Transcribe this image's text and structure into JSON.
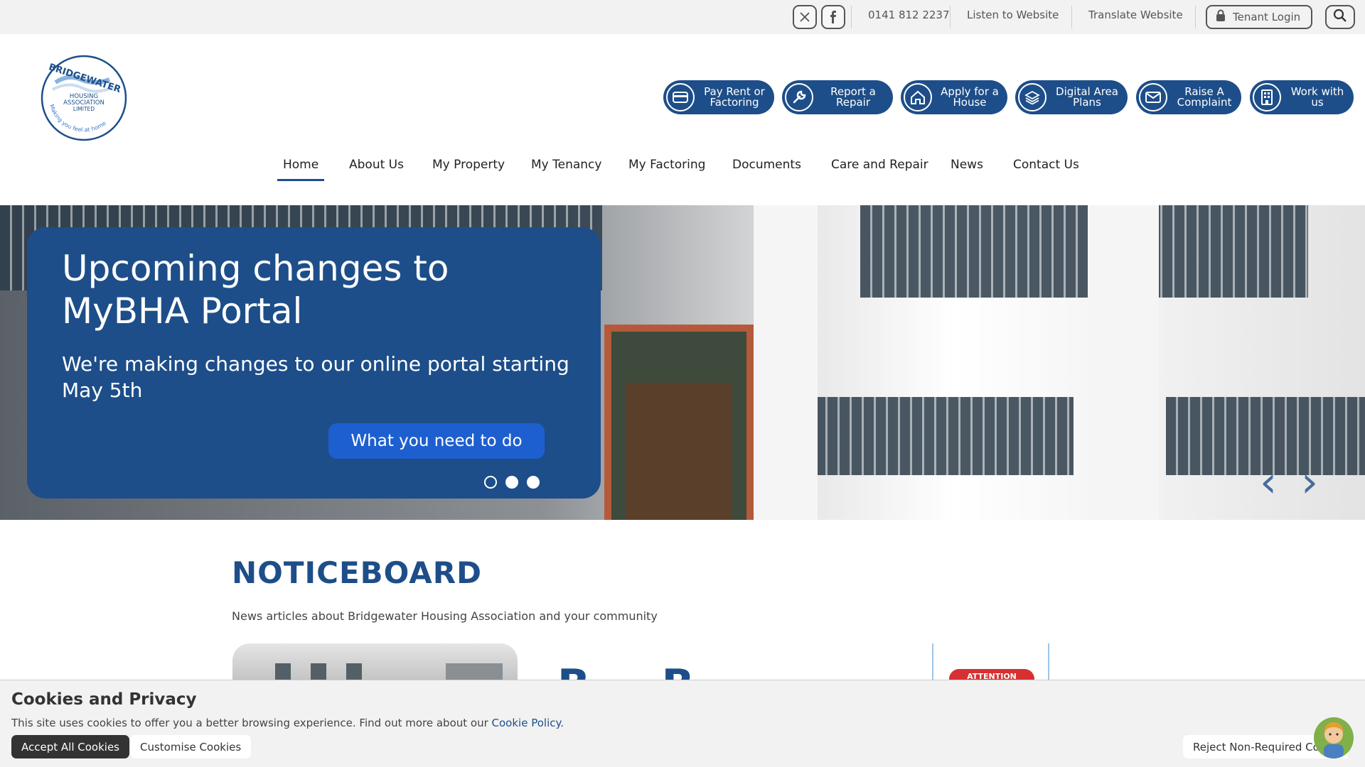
{
  "topbar": {
    "twitter_icon": "x-twitter-icon",
    "facebook_icon": "facebook-icon",
    "phone": "0141 812 2237",
    "listen": "Listen to Website",
    "translate": "Translate Website",
    "tenant_login": "Tenant Login"
  },
  "logo": {
    "name": "BRIDGEWATER",
    "line1": "HOUSING",
    "line2": "ASSOCIATION",
    "line3": "LIMITED",
    "tagline": "Making you feel at home"
  },
  "quick_actions": [
    {
      "label": "Pay Rent or\nFactoring",
      "icon": "card-icon"
    },
    {
      "label": "Report a\nRepair",
      "icon": "wrench-icon"
    },
    {
      "label": "Apply for a\nHouse",
      "icon": "house-icon"
    },
    {
      "label": "Digital Area\nPlans",
      "icon": "layers-icon"
    },
    {
      "label": "Raise A\nComplaint",
      "icon": "envelope-icon"
    },
    {
      "label": "Work with\nus",
      "icon": "building-icon"
    }
  ],
  "nav": [
    {
      "label": "Home",
      "active": true
    },
    {
      "label": "About Us"
    },
    {
      "label": "My Property"
    },
    {
      "label": "My Tenancy"
    },
    {
      "label": "My Factoring"
    },
    {
      "label": "Documents"
    },
    {
      "label": "Care and Repair"
    },
    {
      "label": "News"
    },
    {
      "label": "Contact Us"
    }
  ],
  "hero": {
    "title": "Upcoming changes to MyBHA Portal",
    "subtitle": "We're making changes to our online portal starting May 5th",
    "cta": "What you need to do",
    "slides": 3,
    "active_slide": 1
  },
  "noticeboard": {
    "title": "NOTICEBOARD",
    "description": "News articles about Bridgewater Housing Association and your community",
    "card2_text": "B B",
    "card3_badge": "ATTENTION"
  },
  "cookies": {
    "title": "Cookies and Privacy",
    "text": "This site uses cookies to offer you a better browsing experience. Find out more about our ",
    "link": "Cookie Policy",
    "text_end": ".",
    "accept": "Accept All Cookies",
    "customise": "Customise Cookies",
    "reject": "Reject Non-Required Co..."
  },
  "colors": {
    "brand": "#1d4e89",
    "cta": "#1e5fd0",
    "topbar": "#f2f2f2"
  }
}
